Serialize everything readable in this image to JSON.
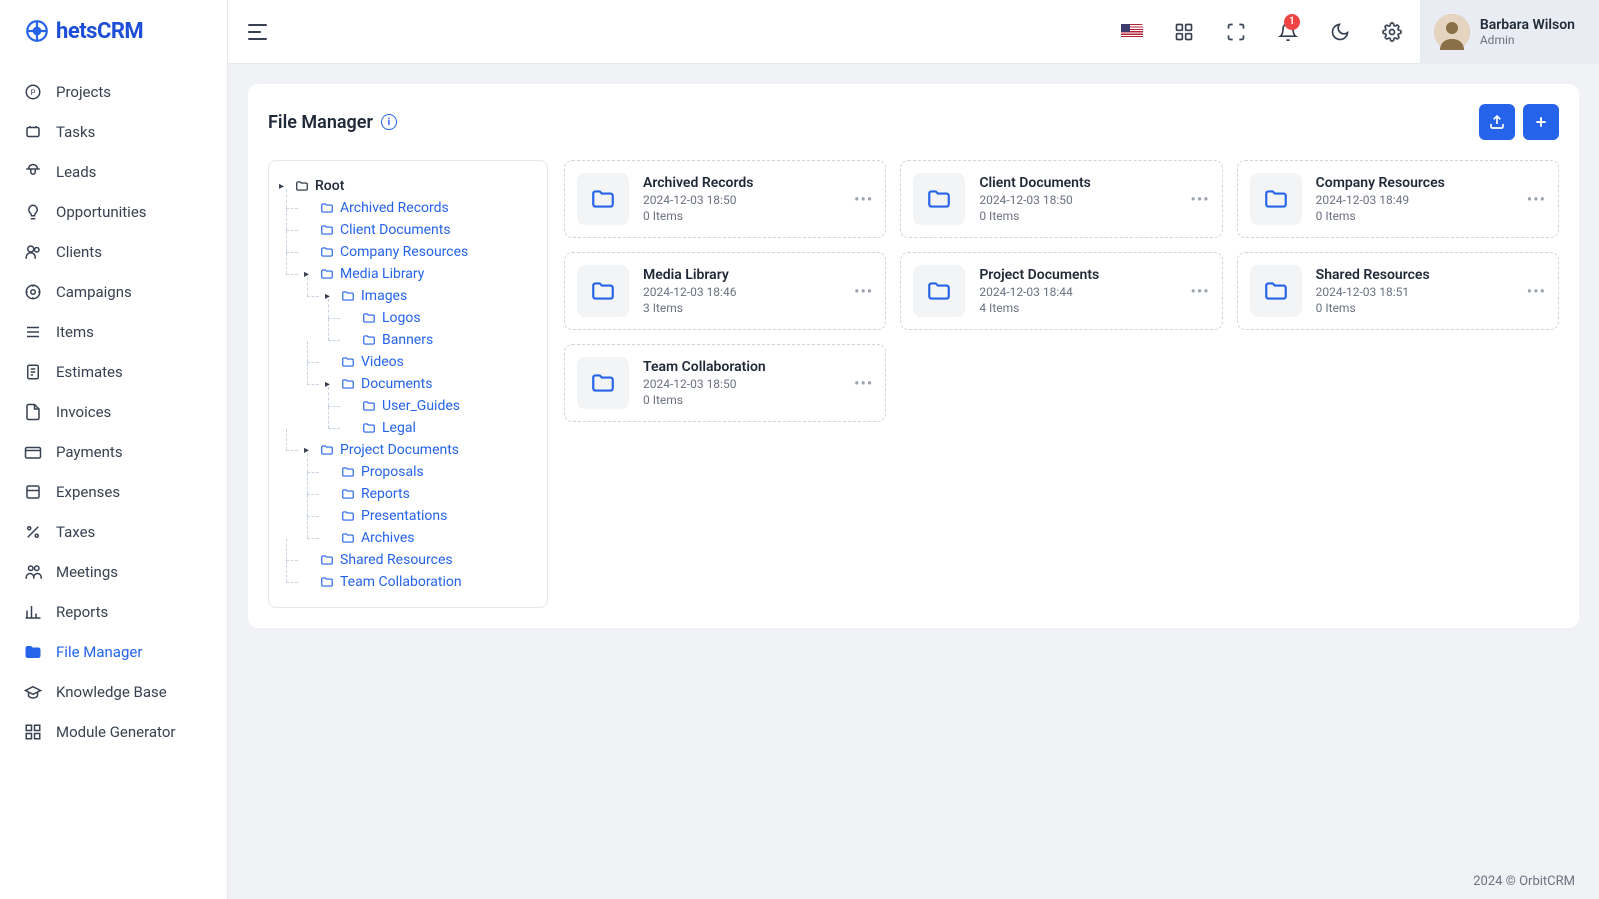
{
  "brand": {
    "name": "hetsCRM"
  },
  "user": {
    "name": "Barbara Wilson",
    "role": "Admin"
  },
  "notifications": {
    "count": "1"
  },
  "nav": [
    {
      "label": "Projects",
      "icon": "projects"
    },
    {
      "label": "Tasks",
      "icon": "tasks"
    },
    {
      "label": "Leads",
      "icon": "leads"
    },
    {
      "label": "Opportunities",
      "icon": "opportunities"
    },
    {
      "label": "Clients",
      "icon": "clients"
    },
    {
      "label": "Campaigns",
      "icon": "campaigns"
    },
    {
      "label": "Items",
      "icon": "items"
    },
    {
      "label": "Estimates",
      "icon": "estimates"
    },
    {
      "label": "Invoices",
      "icon": "invoices"
    },
    {
      "label": "Payments",
      "icon": "payments"
    },
    {
      "label": "Expenses",
      "icon": "expenses"
    },
    {
      "label": "Taxes",
      "icon": "taxes"
    },
    {
      "label": "Meetings",
      "icon": "meetings"
    },
    {
      "label": "Reports",
      "icon": "reports"
    },
    {
      "label": "File Manager",
      "icon": "file-manager",
      "active": true
    },
    {
      "label": "Knowledge Base",
      "icon": "knowledge"
    },
    {
      "label": "Module Generator",
      "icon": "module"
    }
  ],
  "page": {
    "title": "File Manager"
  },
  "tree": {
    "root": "Root",
    "nodes": [
      {
        "label": "Archived Records"
      },
      {
        "label": "Client Documents"
      },
      {
        "label": "Company Resources"
      },
      {
        "label": "Media Library",
        "expanded": true,
        "children": [
          {
            "label": "Images",
            "expanded": true,
            "children": [
              {
                "label": "Logos"
              },
              {
                "label": "Banners"
              }
            ]
          },
          {
            "label": "Videos"
          },
          {
            "label": "Documents",
            "expanded": true,
            "children": [
              {
                "label": "User_Guides"
              },
              {
                "label": "Legal"
              }
            ]
          }
        ]
      },
      {
        "label": "Project Documents",
        "expanded": true,
        "children": [
          {
            "label": "Proposals"
          },
          {
            "label": "Reports"
          },
          {
            "label": "Presentations"
          },
          {
            "label": "Archives"
          }
        ]
      },
      {
        "label": "Shared Resources"
      },
      {
        "label": "Team Collaboration"
      }
    ]
  },
  "folders": [
    {
      "name": "Archived Records",
      "date": "2024-12-03 18:50",
      "items": "0 Items"
    },
    {
      "name": "Client Documents",
      "date": "2024-12-03 18:50",
      "items": "0 Items"
    },
    {
      "name": "Company Resources",
      "date": "2024-12-03 18:49",
      "items": "0 Items"
    },
    {
      "name": "Media Library",
      "date": "2024-12-03 18:46",
      "items": "3 Items"
    },
    {
      "name": "Project Documents",
      "date": "2024-12-03 18:44",
      "items": "4 Items"
    },
    {
      "name": "Shared Resources",
      "date": "2024-12-03 18:51",
      "items": "0 Items"
    },
    {
      "name": "Team Collaboration",
      "date": "2024-12-03 18:50",
      "items": "0 Items"
    }
  ],
  "footer": "2024 © OrbitCRM"
}
